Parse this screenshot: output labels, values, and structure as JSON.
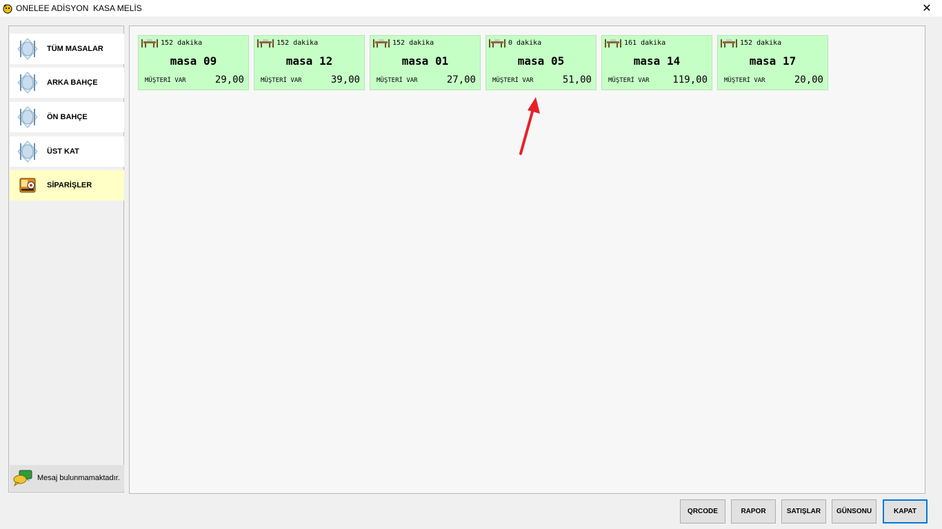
{
  "window": {
    "title": "ONELEE ADİSYON  KASA MELİS",
    "close_glyph": "✕"
  },
  "sidebar": {
    "items": [
      {
        "label": "TÜM MASALAR",
        "icon": "cutlery-plate-icon"
      },
      {
        "label": "ARKA BAHÇE",
        "icon": "cutlery-plate-icon"
      },
      {
        "label": "ÖN BAHÇE",
        "icon": "cutlery-plate-icon"
      },
      {
        "label": "ÜST KAT",
        "icon": "cutlery-plate-icon"
      },
      {
        "label": "SİPARİŞLER",
        "icon": "orders-icon",
        "active": true
      }
    ],
    "message": "Mesaj bulunmamaktadır."
  },
  "tables": [
    {
      "minutes": "152 dakika",
      "name": "masa 09",
      "status": "MÜŞTERİ VAR",
      "amount": "29,00"
    },
    {
      "minutes": "152 dakika",
      "name": "masa 12",
      "status": "MÜŞTERİ VAR",
      "amount": "39,00"
    },
    {
      "minutes": "152 dakika",
      "name": "masa 01",
      "status": "MÜŞTERİ VAR",
      "amount": "27,00"
    },
    {
      "minutes": "0 dakika",
      "name": "masa 05",
      "status": "MÜŞTERİ VAR",
      "amount": "51,00"
    },
    {
      "minutes": "161 dakika",
      "name": "masa 14",
      "status": "MÜŞTERİ VAR",
      "amount": "119,00"
    },
    {
      "minutes": "152 dakika",
      "name": "masa 17",
      "status": "MÜŞTERİ VAR",
      "amount": "20,00"
    }
  ],
  "buttons": {
    "qrcode": "QRCODE",
    "rapor": "RAPOR",
    "satislar": "SATIŞLAR",
    "gunsonu": "GÜNSONU",
    "kapat": "KAPAT"
  },
  "colors": {
    "table_occupied": "#c6ffc6",
    "sidebar_active": "#ffffc6",
    "annotation_arrow": "#e8202a",
    "primary_button_border": "#0078d7"
  }
}
